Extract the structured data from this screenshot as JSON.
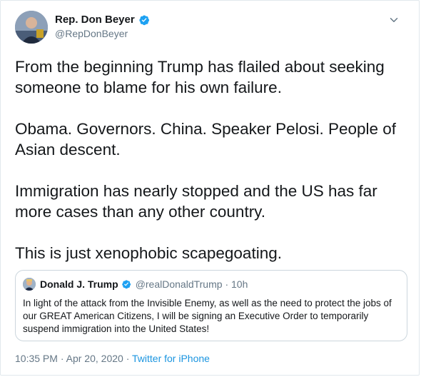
{
  "author": {
    "name": "Rep. Don Beyer",
    "handle": "@RepDonBeyer",
    "avatar_icon": "profile-photo-icon",
    "verified_icon": "verified-badge-icon"
  },
  "menu": {
    "icon": "chevron-down-icon"
  },
  "tweet": {
    "paragraphs": [
      "From the beginning Trump has flailed about seeking someone to blame for his own failure.",
      "Obama. Governors. China. Speaker Pelosi. People of Asian descent.",
      "Immigration has nearly stopped and the US has far more cases than any other country.",
      "This is just xenophobic scapegoating."
    ]
  },
  "quoted_tweet": {
    "name": "Donald J. Trump",
    "handle": "@realDonaldTrump",
    "separator": "·",
    "time": "10h",
    "text": "In light of the attack from the Invisible Enemy, as well as the need to protect the jobs of our GREAT American Citizens, I will be signing an Executive Order to temporarily suspend immigration into the United States!"
  },
  "meta": {
    "time": "10:35 PM",
    "separator1": "·",
    "date": "Apr 20, 2020",
    "separator2": "·",
    "source": "Twitter for iPhone"
  },
  "colors": {
    "verified": "#1da1f2",
    "link": "#1b95e0",
    "secondary_text": "#657786",
    "primary_text": "#14171a",
    "border": "#ccd6dd"
  }
}
